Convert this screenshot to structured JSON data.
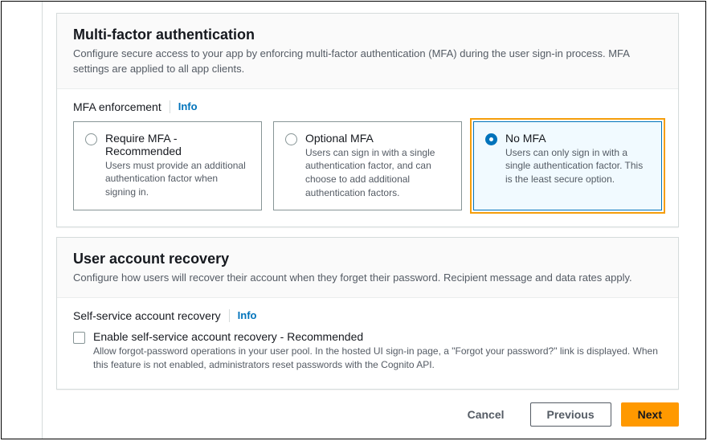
{
  "mfa": {
    "title": "Multi-factor authentication",
    "description": "Configure secure access to your app by enforcing multi-factor authentication (MFA) during the user sign-in process. MFA settings are applied to all app clients.",
    "enforcement_label": "MFA enforcement",
    "info_label": "Info",
    "options": [
      {
        "title": "Require MFA - Recommended",
        "desc": "Users must provide an additional authentication factor when signing in.",
        "selected": false
      },
      {
        "title": "Optional MFA",
        "desc": "Users can sign in with a single authentication factor, and can choose to add additional authentication factors.",
        "selected": false
      },
      {
        "title": "No MFA",
        "desc": "Users can only sign in with a single authentication factor. This is the least secure option.",
        "selected": true
      }
    ]
  },
  "recovery": {
    "title": "User account recovery",
    "description": "Configure how users will recover their account when they forget their password. Recipient message and data rates apply.",
    "self_service_label": "Self-service account recovery",
    "info_label": "Info",
    "checkbox_title": "Enable self-service account recovery - Recommended",
    "checkbox_desc": "Allow forgot-password operations in your user pool. In the hosted UI sign-in page, a \"Forgot your password?\" link is displayed. When this feature is not enabled, administrators reset passwords with the Cognito API.",
    "checkbox_checked": false
  },
  "footer": {
    "cancel": "Cancel",
    "previous": "Previous",
    "next": "Next"
  }
}
